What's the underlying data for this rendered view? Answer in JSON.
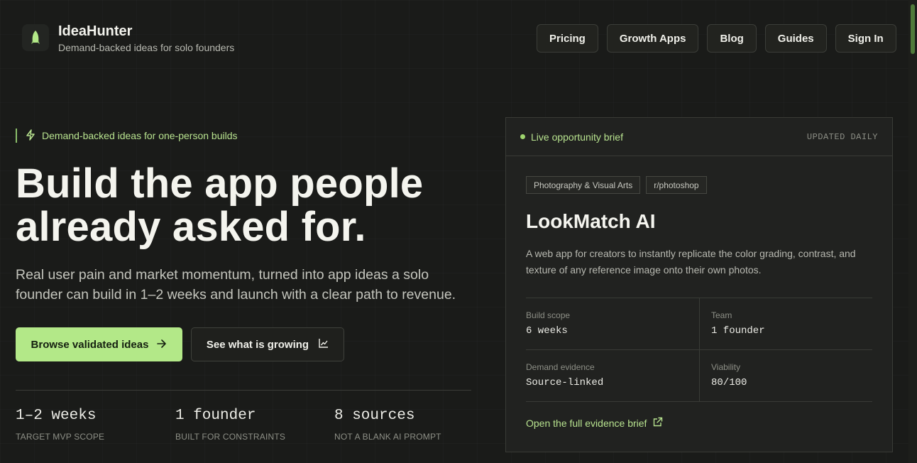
{
  "brand": {
    "title": "IdeaHunter",
    "subtitle": "Demand-backed ideas for solo founders"
  },
  "nav": {
    "items": [
      "Pricing",
      "Growth Apps",
      "Blog",
      "Guides",
      "Sign In"
    ]
  },
  "hero": {
    "eyebrow": "Demand-backed ideas for one-person builds",
    "title": "Build the app people already asked for.",
    "subtitle": "Real user pain and market momentum, turned into app ideas a solo founder can build in 1–2 weeks and launch with a clear path to revenue.",
    "primary_cta": "Browse validated ideas",
    "secondary_cta": "See what is growing"
  },
  "stats": [
    {
      "value": "1–2 weeks",
      "label": "TARGET MVP SCOPE"
    },
    {
      "value": "1 founder",
      "label": "BUILT FOR CONSTRAINTS"
    },
    {
      "value": "8 sources",
      "label": "NOT A BLANK AI PROMPT"
    }
  ],
  "card": {
    "live_label": "Live opportunity brief",
    "updated_label": "UPDATED DAILY",
    "tags": [
      "Photography & Visual Arts",
      "r/photoshop"
    ],
    "title": "LookMatch AI",
    "description": "A web app for creators to instantly replicate the color grading, contrast, and texture of any reference image onto their own photos.",
    "facts": [
      {
        "label": "Build scope",
        "value": "6 weeks"
      },
      {
        "label": "Team",
        "value": "1 founder"
      },
      {
        "label": "Demand evidence",
        "value": "Source-linked"
      },
      {
        "label": "Viability",
        "value": "80/100"
      }
    ],
    "link_label": "Open the full evidence brief"
  },
  "colors": {
    "background": "#1a1b19",
    "accent": "#b3e888",
    "accent_text": "#b8e38f"
  },
  "icons": {
    "logo": "rocket-icon",
    "eyebrow": "bolt-icon",
    "primary_cta": "arrow-right-icon",
    "secondary_cta": "chart-icon",
    "link": "external-link-icon"
  }
}
